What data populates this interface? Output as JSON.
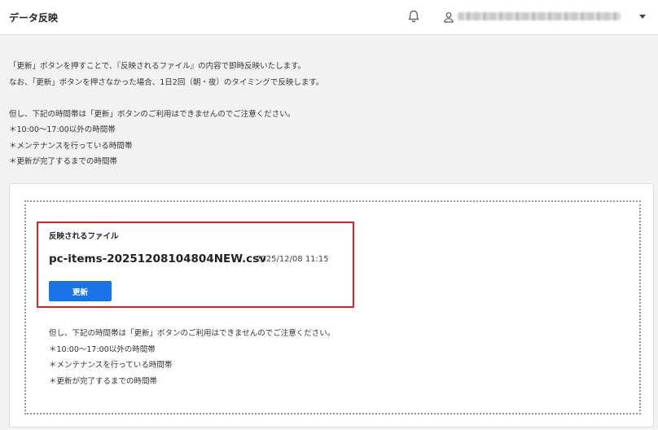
{
  "header": {
    "title": "データ反映",
    "bell_icon": "bell-icon",
    "user_icon": "user-icon",
    "caret_icon": "caret-down-icon"
  },
  "intro": {
    "lines": [
      "「更新」ボタンを押すことで、『反映されるファイル』の内容で即時反映いたします。",
      "なお、「更新」ボタンを押さなかった場合、1日2回（朝・夜）のタイミングで反映します。",
      "",
      "但し、下記の時間帯は「更新」ボタンのご利用はできませんのでご注意ください。",
      "＊10:00～17:00以外の時間帯",
      "＊メンテナンスを行っている時間帯",
      "＊更新が完了するまでの時間帯"
    ]
  },
  "card": {
    "file_label": "反映されるファイル",
    "file_name": "pc-items-20251208104804NEW.csv",
    "file_date": "2025/12/08 11:15",
    "update_button": "更新",
    "note_lines": [
      "但し、下記の時間帯は「更新」ボタンのご利用はできませんのでご注意ください。",
      "＊10:00～17:00以外の時間帯",
      "＊メンテナンスを行っている時間帯",
      "＊更新が完了するまでの時間帯"
    ]
  },
  "colors": {
    "accent": "#1a73e8",
    "highlight": "#e02020",
    "background": "#f2f2f2"
  }
}
